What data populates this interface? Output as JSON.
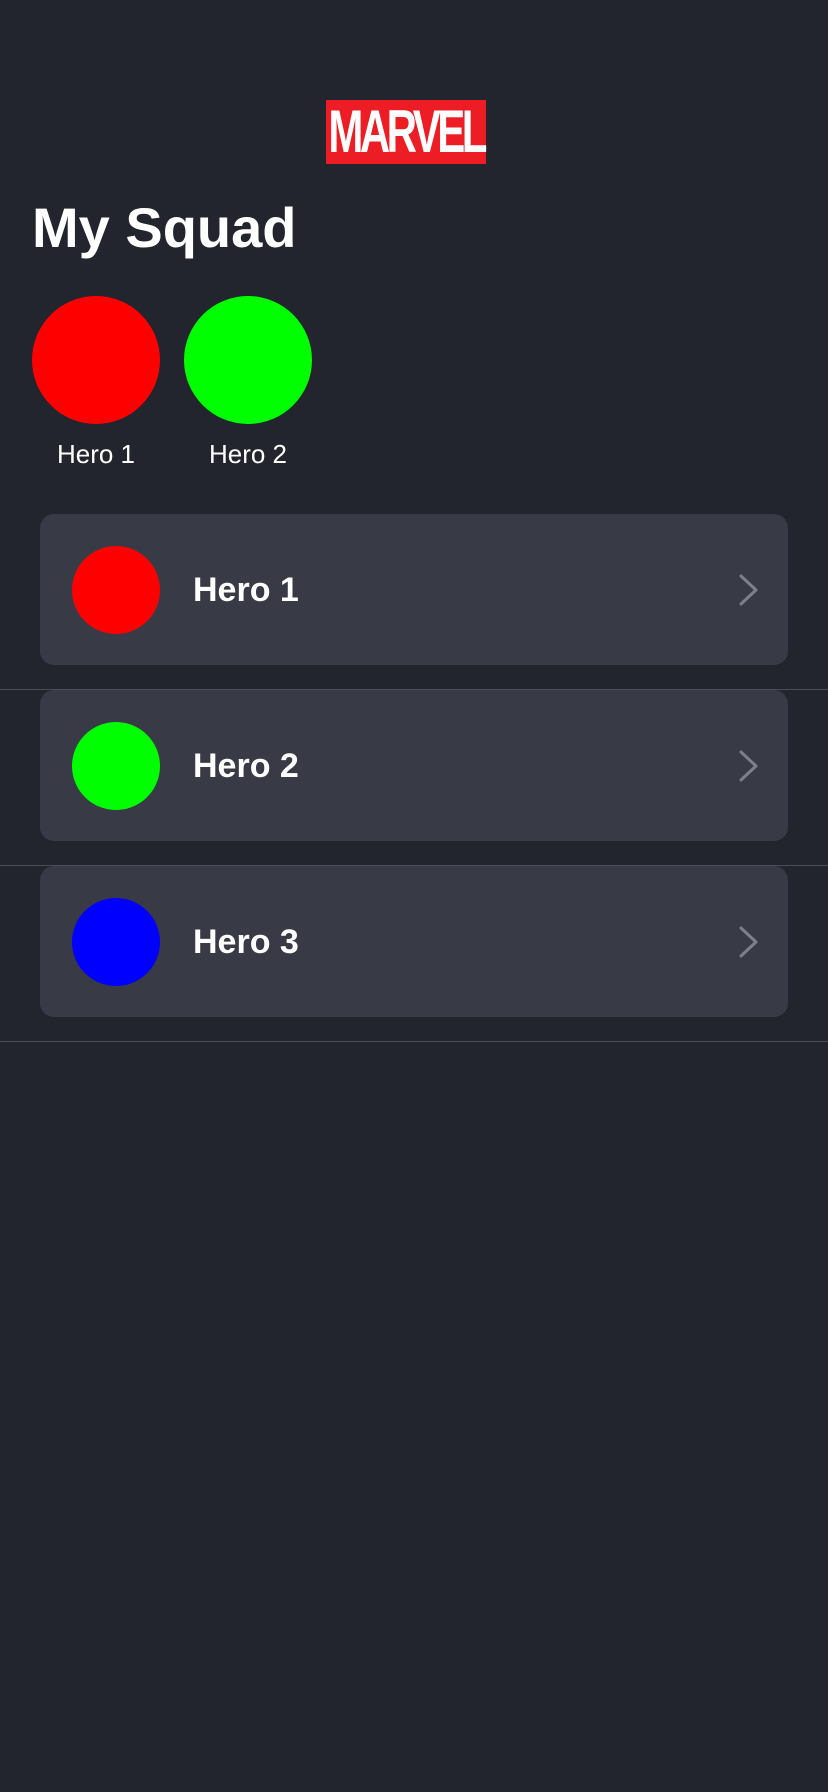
{
  "header": {
    "logo_text": "MARVEL"
  },
  "page": {
    "title": "My Squad"
  },
  "squad": [
    {
      "name": "Hero 1",
      "color": "#ff0000"
    },
    {
      "name": "Hero 2",
      "color": "#00ff00"
    }
  ],
  "heroes": [
    {
      "name": "Hero 1",
      "color": "#ff0000",
      "icon": "chevron-right-icon"
    },
    {
      "name": "Hero 2",
      "color": "#00ff00",
      "icon": "chevron-right-icon"
    },
    {
      "name": "Hero 3",
      "color": "#0000ff",
      "icon": "chevron-right-icon"
    }
  ],
  "theme": {
    "background": "#22252d",
    "card": "#383a45",
    "brand_red": "#ec1d24"
  }
}
